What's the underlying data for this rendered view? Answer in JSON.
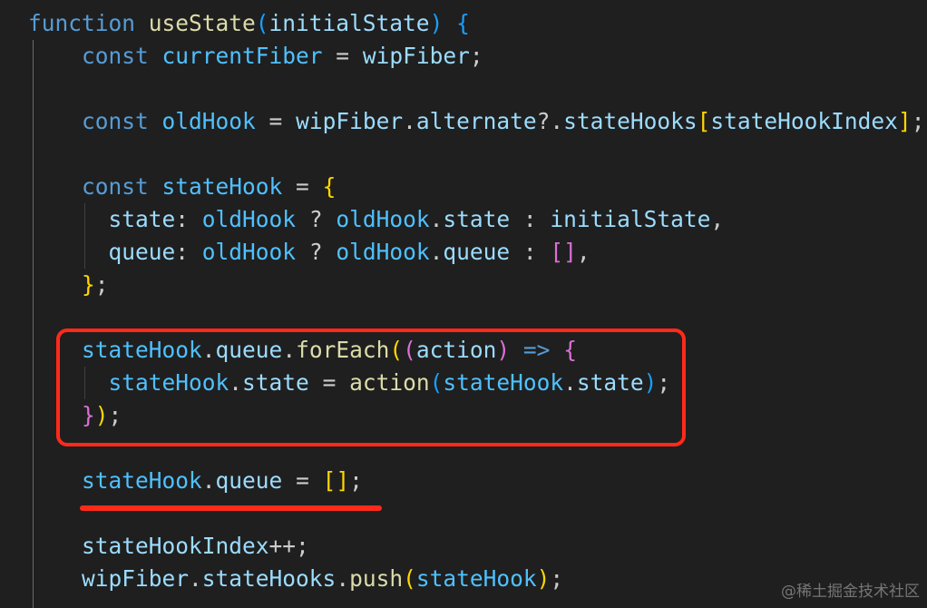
{
  "colors": {
    "background": "#1f1f1f",
    "keyword": "#569cd6",
    "function": "#dcdcaa",
    "variable": "#9cdcfe",
    "constant": "#4fc1ff",
    "punctuation": "#cccccc",
    "bracket_1": "#ffd700",
    "bracket_2": "#da70d6",
    "bracket_3": "#179fff",
    "annotation": "#ff2a1a"
  },
  "code_lines": [
    [
      [
        "function ",
        "kw"
      ],
      [
        "useState",
        "fn"
      ],
      [
        "(",
        "b3"
      ],
      [
        "initialState",
        "var"
      ],
      [
        ")",
        "b3"
      ],
      [
        " ",
        "p"
      ],
      [
        "{",
        "b3"
      ]
    ],
    [
      [
        "    ",
        "p"
      ],
      [
        "const ",
        "kw"
      ],
      [
        "currentFiber",
        "const"
      ],
      [
        " = ",
        "p"
      ],
      [
        "wipFiber",
        "var"
      ],
      [
        ";",
        "p"
      ]
    ],
    [],
    [
      [
        "    ",
        "p"
      ],
      [
        "const ",
        "kw"
      ],
      [
        "oldHook",
        "const"
      ],
      [
        " = ",
        "p"
      ],
      [
        "wipFiber",
        "var"
      ],
      [
        ".",
        "p"
      ],
      [
        "alternate",
        "var"
      ],
      [
        "?.",
        "p"
      ],
      [
        "stateHooks",
        "var"
      ],
      [
        "[",
        "b1"
      ],
      [
        "stateHookIndex",
        "var"
      ],
      [
        "]",
        "b1"
      ],
      [
        ";",
        "p"
      ]
    ],
    [],
    [
      [
        "    ",
        "p"
      ],
      [
        "const ",
        "kw"
      ],
      [
        "stateHook",
        "const"
      ],
      [
        " = ",
        "p"
      ],
      [
        "{",
        "b1"
      ]
    ],
    [
      [
        "      ",
        "p"
      ],
      [
        "state",
        "var"
      ],
      [
        ": ",
        "p"
      ],
      [
        "oldHook",
        "const"
      ],
      [
        " ? ",
        "p"
      ],
      [
        "oldHook",
        "const"
      ],
      [
        ".",
        "p"
      ],
      [
        "state",
        "var"
      ],
      [
        " : ",
        "p"
      ],
      [
        "initialState",
        "var"
      ],
      [
        ",",
        "p"
      ]
    ],
    [
      [
        "      ",
        "p"
      ],
      [
        "queue",
        "var"
      ],
      [
        ": ",
        "p"
      ],
      [
        "oldHook",
        "const"
      ],
      [
        " ? ",
        "p"
      ],
      [
        "oldHook",
        "const"
      ],
      [
        ".",
        "p"
      ],
      [
        "queue",
        "var"
      ],
      [
        " : ",
        "p"
      ],
      [
        "[",
        "b2"
      ],
      [
        "]",
        "b2"
      ],
      [
        ",",
        "p"
      ]
    ],
    [
      [
        "    ",
        "p"
      ],
      [
        "}",
        "b1"
      ],
      [
        ";",
        "p"
      ]
    ],
    [],
    [
      [
        "    ",
        "p"
      ],
      [
        "stateHook",
        "const"
      ],
      [
        ".",
        "p"
      ],
      [
        "queue",
        "var"
      ],
      [
        ".",
        "p"
      ],
      [
        "forEach",
        "fn"
      ],
      [
        "(",
        "b1"
      ],
      [
        "(",
        "b2"
      ],
      [
        "action",
        "var"
      ],
      [
        ")",
        "b2"
      ],
      [
        " ",
        "p"
      ],
      [
        "=>",
        "kw"
      ],
      [
        " ",
        "p"
      ],
      [
        "{",
        "b2"
      ]
    ],
    [
      [
        "      ",
        "p"
      ],
      [
        "stateHook",
        "const"
      ],
      [
        ".",
        "p"
      ],
      [
        "state",
        "var"
      ],
      [
        " = ",
        "p"
      ],
      [
        "action",
        "fn"
      ],
      [
        "(",
        "b3"
      ],
      [
        "stateHook",
        "const"
      ],
      [
        ".",
        "p"
      ],
      [
        "state",
        "var"
      ],
      [
        ")",
        "b3"
      ],
      [
        ";",
        "p"
      ]
    ],
    [
      [
        "    ",
        "p"
      ],
      [
        "}",
        "b2"
      ],
      [
        ")",
        "b1"
      ],
      [
        ";",
        "p"
      ]
    ],
    [],
    [
      [
        "    ",
        "p"
      ],
      [
        "stateHook",
        "const"
      ],
      [
        ".",
        "p"
      ],
      [
        "queue",
        "var"
      ],
      [
        " = ",
        "p"
      ],
      [
        "[",
        "b1"
      ],
      [
        "]",
        "b1"
      ],
      [
        ";",
        "p"
      ]
    ],
    [],
    [
      [
        "    ",
        "p"
      ],
      [
        "stateHookIndex",
        "var"
      ],
      [
        "++;",
        "p"
      ]
    ],
    [
      [
        "    ",
        "p"
      ],
      [
        "wipFiber",
        "var"
      ],
      [
        ".",
        "p"
      ],
      [
        "stateHooks",
        "var"
      ],
      [
        ".",
        "p"
      ],
      [
        "push",
        "fn"
      ],
      [
        "(",
        "b1"
      ],
      [
        "stateHook",
        "const"
      ],
      [
        ")",
        "b1"
      ],
      [
        ";",
        "p"
      ]
    ]
  ],
  "watermark": "@稀土掘金技术社区"
}
